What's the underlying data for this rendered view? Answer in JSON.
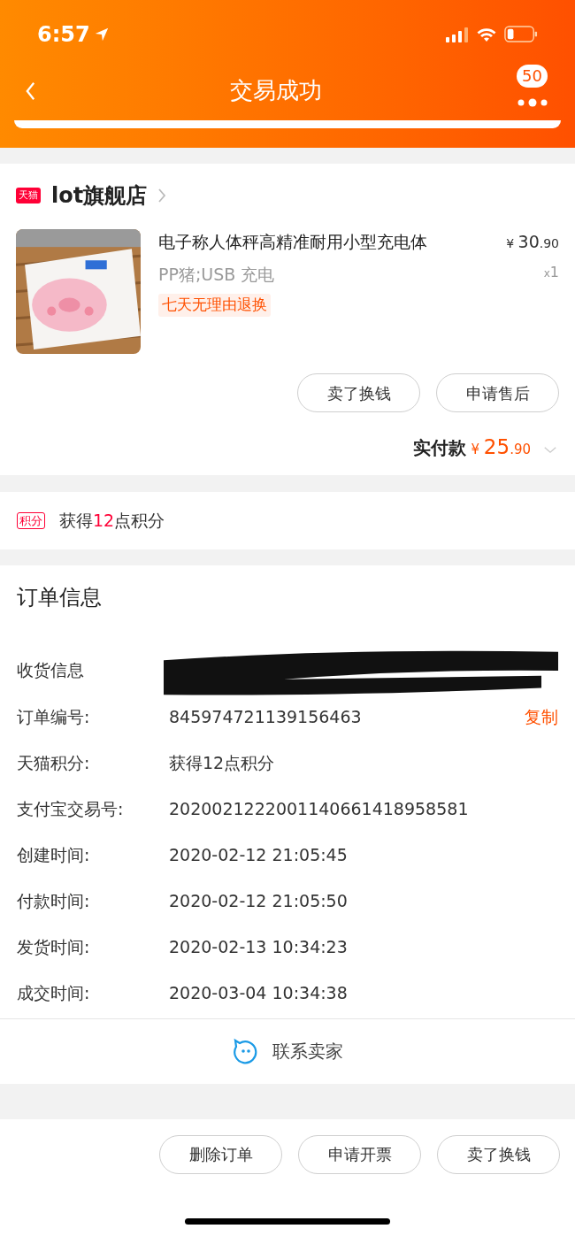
{
  "status_bar": {
    "time": "6:57"
  },
  "nav": {
    "title": "交易成功",
    "badge": "50"
  },
  "store": {
    "badge": "天猫",
    "name": "lot旗舰店"
  },
  "product": {
    "title": "电子称人体秤高精准耐用小型充电体",
    "spec": "PP猪;USB 充电",
    "tag": "七天无理由退换",
    "price_symbol": "¥",
    "price_int": "30",
    "price_dec": ".90",
    "qty_prefix": "x",
    "qty": "1"
  },
  "product_actions": [
    "卖了换钱",
    "申请售后"
  ],
  "paid": {
    "label": "实付款",
    "symbol": "¥",
    "int": "25",
    "dec": ".90"
  },
  "points": {
    "badge": "积分",
    "text_before": "获得",
    "number": "12",
    "text_after": "点积分"
  },
  "order_info": {
    "title": "订单信息",
    "address_label": "收货信息",
    "rows": [
      {
        "label": "订单编号:",
        "value": "845974721139156463",
        "action": "复制"
      },
      {
        "label": "天猫积分:",
        "value": "获得12点积分"
      },
      {
        "label": "支付宝交易号:",
        "value": "2020021222001140661418958581"
      },
      {
        "label": "创建时间:",
        "value": "2020-02-12 21:05:45"
      },
      {
        "label": "付款时间:",
        "value": "2020-02-12 21:05:50"
      },
      {
        "label": "发货时间:",
        "value": "2020-02-13 10:34:23"
      },
      {
        "label": "成交时间:",
        "value": "2020-03-04 10:34:38"
      }
    ]
  },
  "contact": {
    "label": "联系卖家"
  },
  "bottom_actions": [
    "删除订单",
    "申请开票",
    "卖了换钱"
  ]
}
